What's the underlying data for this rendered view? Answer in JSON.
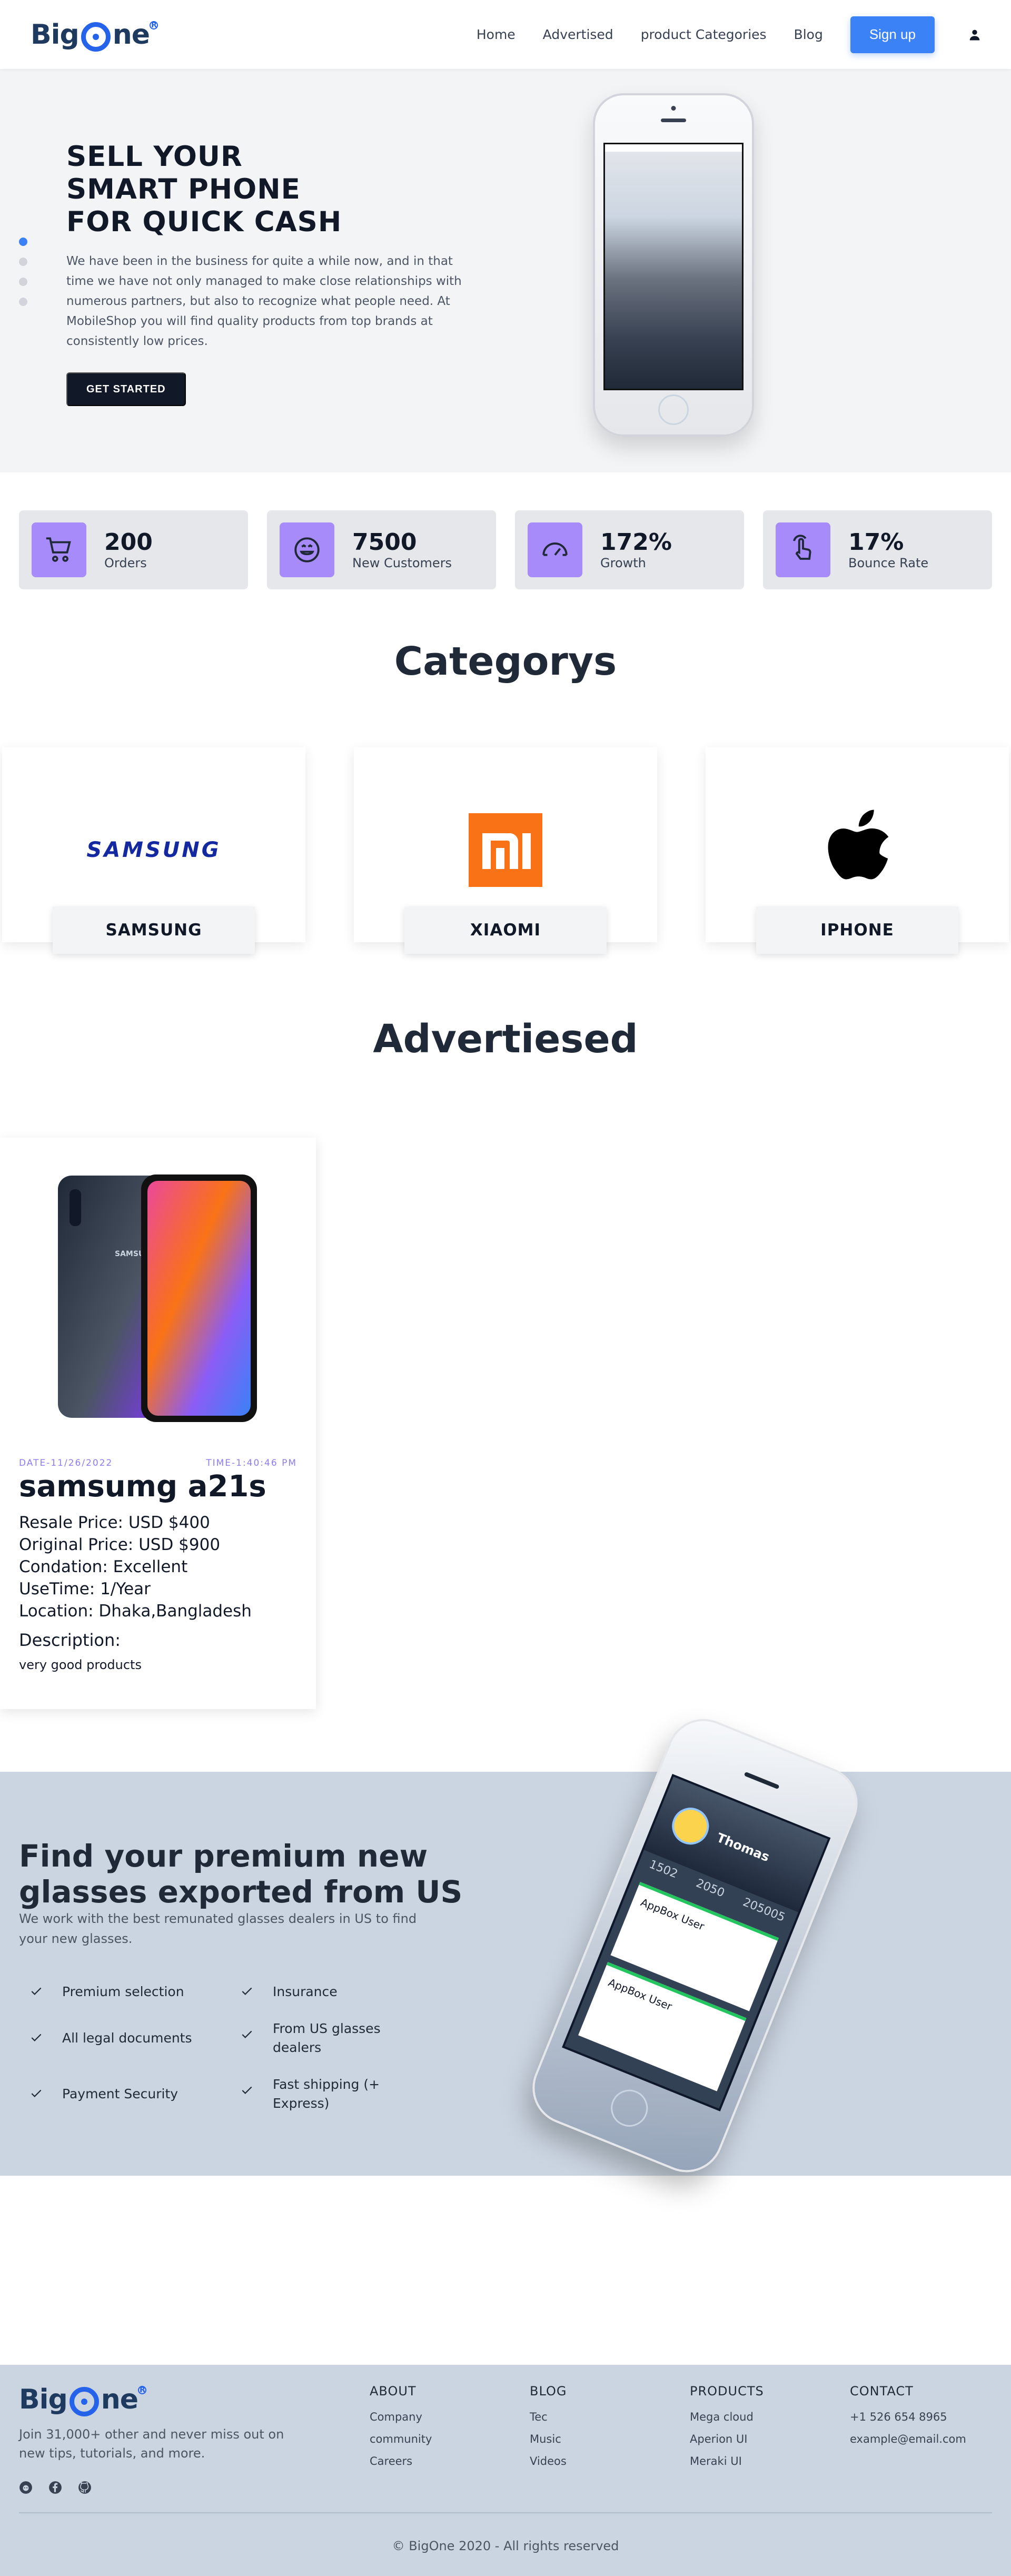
{
  "header": {
    "logo_left": "Big",
    "logo_right": "ne",
    "nav": [
      "Home",
      "Advertised",
      "product Categories",
      "Blog"
    ],
    "signup_label": "Sign up",
    "user_icon": "user-icon"
  },
  "hero": {
    "title_lines": [
      "SELL YOUR",
      "SMART PHONE",
      "FOR QUICK CASH"
    ],
    "description": "We have been in the business for quite a while now, and in that time we have not only managed to make close relationships with numerous partners, but also to recognize what people need. At MobileShop you will find quality products from top brands at consistently low prices.",
    "cta_label": "GET STARTED",
    "slide_count": 4,
    "active_slide": 1
  },
  "stats": [
    {
      "value": "200",
      "label": "Orders",
      "icon": "cart-icon"
    },
    {
      "value": "7500",
      "label": "New Customers",
      "icon": "smile-icon"
    },
    {
      "value": "172%",
      "label": "Growth",
      "icon": "gauge-icon"
    },
    {
      "value": "17%",
      "label": "Bounce Rate",
      "icon": "pointer-icon"
    }
  ],
  "categories_title": "Categorys",
  "categories": [
    {
      "label": "SAMSUNG",
      "logo_text": "SAMSUNG"
    },
    {
      "label": "XIAOMI",
      "logo_text": "mi"
    },
    {
      "label": "IPHONE",
      "logo_text": ""
    }
  ],
  "advertised_title": "Advertiesed",
  "advert": {
    "date": "DATE-11/26/2022",
    "time": "TIME-1:40:46 PM",
    "title": "samsumg a21s",
    "resale_price": "Resale Price: USD $400",
    "original_price": "Original Price: USD $900",
    "condition": "Condation: Excellent",
    "use_time": "UseTime: 1/Year",
    "location": "Location: Dhaka,Bangladesh",
    "description_title": "Description:",
    "description": "very good products",
    "phone_brand_text": "SAMSUNG"
  },
  "promo": {
    "title": "Find your premium new glasses exported from US",
    "subtitle": "We work with the best remunated glasses dealers in US to find your new glasses.",
    "features": [
      "Premium selection",
      "Insurance",
      "All legal documents",
      "From US glasses dealers",
      "Payment Security",
      "Fast shipping (+ Express)"
    ],
    "phone": {
      "name": "Thomas",
      "stats": [
        "1502",
        "2050",
        "205005"
      ],
      "card_title": "AppBox User"
    }
  },
  "footer": {
    "tagline": "Join 31,000+ other and never miss out on new tips, tutorials, and more.",
    "columns": [
      {
        "title": "ABOUT",
        "links": [
          "Company",
          "community",
          "Careers"
        ]
      },
      {
        "title": "BLOG",
        "links": [
          "Tec",
          "Music",
          "Videos"
        ]
      },
      {
        "title": "PRODUCTS",
        "links": [
          "Mega cloud",
          "Aperion UI",
          "Meraki UI"
        ]
      },
      {
        "title": "CONTACT",
        "links": [
          "+1 526 654 8965",
          "example@email.com"
        ]
      }
    ],
    "social_icons": [
      "reddit-icon",
      "facebook-icon",
      "github-icon"
    ],
    "copyright": "© BigOne 2020 - All rights reserved"
  },
  "colors": {
    "accent": "#3b82f6",
    "stat_icon_bg": "#a78bfa",
    "promo_bg": "#cbd5e1",
    "hero_bg": "#f3f4f6"
  }
}
